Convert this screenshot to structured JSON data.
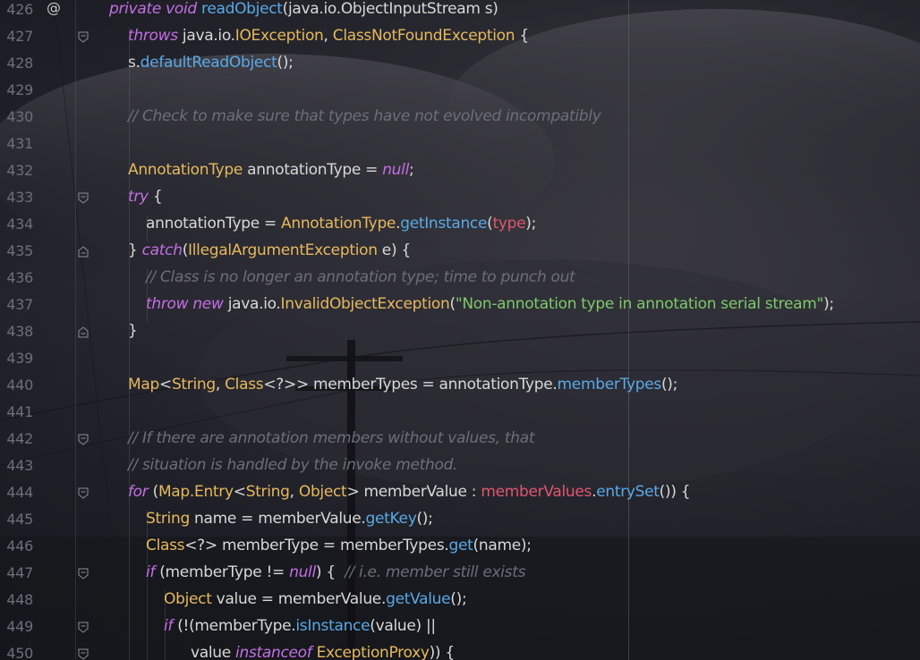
{
  "editor": {
    "accent": "#c36fe4",
    "colors": {
      "keyword": "#c36fe4",
      "type": "#e6b95e",
      "function": "#5aa9e6",
      "field": "#e2566f",
      "string": "#7ec96a",
      "comment": "#6c6f78",
      "default": "#d8d8d8"
    },
    "gutter_marker_426": "@",
    "lines": [
      {
        "num": "426",
        "indent": 122,
        "tokens": [
          {
            "c": "kw",
            "t": "private void "
          },
          {
            "c": "fn",
            "t": "readObject"
          },
          {
            "c": "df",
            "t": "(java.io.ObjectInputStream s)"
          }
        ]
      },
      {
        "num": "427",
        "indent": 143,
        "tokens": [
          {
            "c": "kw",
            "t": "throws "
          },
          {
            "c": "df",
            "t": "java.io."
          },
          {
            "c": "ty",
            "t": "IOException"
          },
          {
            "c": "df",
            "t": ", "
          },
          {
            "c": "ty",
            "t": "ClassNotFoundException"
          },
          {
            "c": "df",
            "t": " {"
          }
        ]
      },
      {
        "num": "428",
        "indent": 143,
        "tokens": [
          {
            "c": "df",
            "t": "s."
          },
          {
            "c": "fn",
            "t": "defaultReadObject"
          },
          {
            "c": "df",
            "t": "();"
          }
        ]
      },
      {
        "num": "429",
        "indent": 143,
        "tokens": []
      },
      {
        "num": "430",
        "indent": 143,
        "tokens": [
          {
            "c": "cm",
            "t": "// Check to make sure that types have not evolved incompatibly"
          }
        ]
      },
      {
        "num": "431",
        "indent": 143,
        "tokens": []
      },
      {
        "num": "432",
        "indent": 143,
        "tokens": [
          {
            "c": "ty",
            "t": "AnnotationType"
          },
          {
            "c": "df",
            "t": " annotationType = "
          },
          {
            "c": "kw",
            "t": "null"
          },
          {
            "c": "df",
            "t": ";"
          }
        ]
      },
      {
        "num": "433",
        "indent": 143,
        "tokens": [
          {
            "c": "kw",
            "t": "try "
          },
          {
            "c": "df",
            "t": "{"
          }
        ]
      },
      {
        "num": "434",
        "indent": 163,
        "tokens": [
          {
            "c": "df",
            "t": "annotationType = "
          },
          {
            "c": "ty",
            "t": "AnnotationType"
          },
          {
            "c": "df",
            "t": "."
          },
          {
            "c": "fn",
            "t": "getInstance"
          },
          {
            "c": "df",
            "t": "("
          },
          {
            "c": "fld",
            "t": "type"
          },
          {
            "c": "df",
            "t": ");"
          }
        ]
      },
      {
        "num": "435",
        "indent": 143,
        "tokens": [
          {
            "c": "df",
            "t": "} "
          },
          {
            "c": "kw",
            "t": "catch"
          },
          {
            "c": "df",
            "t": "("
          },
          {
            "c": "ty",
            "t": "IllegalArgumentException"
          },
          {
            "c": "df",
            "t": " e) {"
          }
        ]
      },
      {
        "num": "436",
        "indent": 163,
        "tokens": [
          {
            "c": "cm",
            "t": "// Class is no longer an annotation type; time to punch out"
          }
        ]
      },
      {
        "num": "437",
        "indent": 163,
        "tokens": [
          {
            "c": "kw",
            "t": "throw new "
          },
          {
            "c": "df",
            "t": "java.io."
          },
          {
            "c": "ty",
            "t": "InvalidObjectException"
          },
          {
            "c": "df",
            "t": "("
          },
          {
            "c": "str",
            "t": "\"Non-annotation type in annotation serial stream\""
          },
          {
            "c": "df",
            "t": ");"
          }
        ]
      },
      {
        "num": "438",
        "indent": 143,
        "tokens": [
          {
            "c": "df",
            "t": "}"
          }
        ]
      },
      {
        "num": "439",
        "indent": 143,
        "tokens": []
      },
      {
        "num": "440",
        "indent": 143,
        "tokens": [
          {
            "c": "ty",
            "t": "Map"
          },
          {
            "c": "df",
            "t": "<"
          },
          {
            "c": "ty",
            "t": "String"
          },
          {
            "c": "df",
            "t": ", "
          },
          {
            "c": "ty",
            "t": "Class"
          },
          {
            "c": "df",
            "t": "<?>> memberTypes = annotationType."
          },
          {
            "c": "fn",
            "t": "memberTypes"
          },
          {
            "c": "df",
            "t": "();"
          }
        ]
      },
      {
        "num": "441",
        "indent": 143,
        "tokens": []
      },
      {
        "num": "442",
        "indent": 143,
        "tokens": [
          {
            "c": "cm",
            "t": "// If there are annotation members without values, that"
          }
        ]
      },
      {
        "num": "443",
        "indent": 143,
        "tokens": [
          {
            "c": "cm",
            "t": "// situation is handled by the invoke method."
          }
        ]
      },
      {
        "num": "444",
        "indent": 143,
        "tokens": [
          {
            "c": "kw",
            "t": "for "
          },
          {
            "c": "df",
            "t": "("
          },
          {
            "c": "ty",
            "t": "Map.Entry"
          },
          {
            "c": "df",
            "t": "<"
          },
          {
            "c": "ty",
            "t": "String"
          },
          {
            "c": "df",
            "t": ", "
          },
          {
            "c": "ty",
            "t": "Object"
          },
          {
            "c": "df",
            "t": "> memberValue : "
          },
          {
            "c": "fld",
            "t": "memberValues"
          },
          {
            "c": "df",
            "t": "."
          },
          {
            "c": "fn",
            "t": "entrySet"
          },
          {
            "c": "df",
            "t": "()) {"
          }
        ]
      },
      {
        "num": "445",
        "indent": 163,
        "tokens": [
          {
            "c": "ty",
            "t": "String"
          },
          {
            "c": "df",
            "t": " name = memberValue."
          },
          {
            "c": "fn",
            "t": "getKey"
          },
          {
            "c": "df",
            "t": "();"
          }
        ]
      },
      {
        "num": "446",
        "indent": 163,
        "tokens": [
          {
            "c": "ty",
            "t": "Class"
          },
          {
            "c": "df",
            "t": "<?> memberType = memberTypes."
          },
          {
            "c": "fn",
            "t": "get"
          },
          {
            "c": "df",
            "t": "(name);"
          }
        ]
      },
      {
        "num": "447",
        "indent": 163,
        "tokens": [
          {
            "c": "kw",
            "t": "if "
          },
          {
            "c": "df",
            "t": "(memberType != "
          },
          {
            "c": "kw",
            "t": "null"
          },
          {
            "c": "df",
            "t": ") {  "
          },
          {
            "c": "cm",
            "t": "// i.e. member still exists"
          }
        ]
      },
      {
        "num": "448",
        "indent": 183,
        "tokens": [
          {
            "c": "ty",
            "t": "Object"
          },
          {
            "c": "df",
            "t": " value = memberValue."
          },
          {
            "c": "fn",
            "t": "getValue"
          },
          {
            "c": "df",
            "t": "();"
          }
        ]
      },
      {
        "num": "449",
        "indent": 183,
        "tokens": [
          {
            "c": "kw",
            "t": "if "
          },
          {
            "c": "df",
            "t": "(!(memberType."
          },
          {
            "c": "fn",
            "t": "isInstance"
          },
          {
            "c": "df",
            "t": "(value) ||"
          }
        ]
      },
      {
        "num": "450",
        "indent": 213,
        "tokens": [
          {
            "c": "df",
            "t": "value "
          },
          {
            "c": "kw",
            "t": "instanceof "
          },
          {
            "c": "ty",
            "t": "ExceptionProxy"
          },
          {
            "c": "df",
            "t": ")) {"
          }
        ]
      }
    ]
  }
}
